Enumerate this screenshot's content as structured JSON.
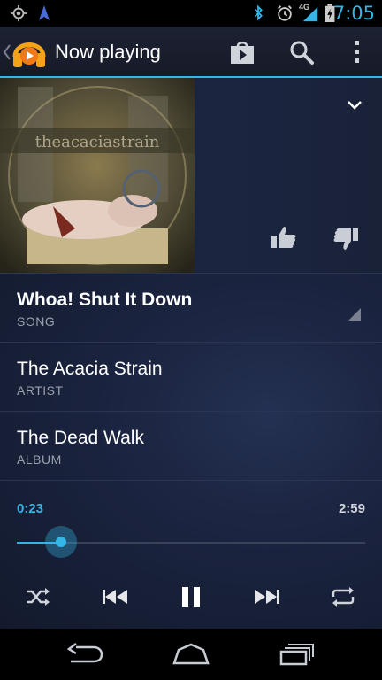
{
  "status": {
    "time": "7:05",
    "network": "4G",
    "icons": [
      "gps-icon",
      "navigation-icon",
      "bluetooth-icon",
      "alarm-icon",
      "signal-icon",
      "battery-charging-icon"
    ]
  },
  "action_bar": {
    "title": "Now playing",
    "icons": [
      "back-caret-icon",
      "headphones-app-icon",
      "shop-icon",
      "search-icon",
      "overflow-menu-icon"
    ]
  },
  "track": {
    "song": "Whoa! Shut It Down",
    "song_label": "SONG",
    "artist": "The Acacia Strain",
    "artist_label": "ARTIST",
    "album": "The Dead Walk",
    "album_label": "ALBUM"
  },
  "playback": {
    "current_time": "0:23",
    "total_time": "2:59",
    "progress": 0.128
  },
  "controls": [
    "shuffle-icon",
    "previous-icon",
    "pause-icon",
    "next-icon",
    "repeat-icon"
  ],
  "colors": {
    "accent": "#33b5e5",
    "background": "#1b2440",
    "text_secondary": "#9aa0ad"
  }
}
